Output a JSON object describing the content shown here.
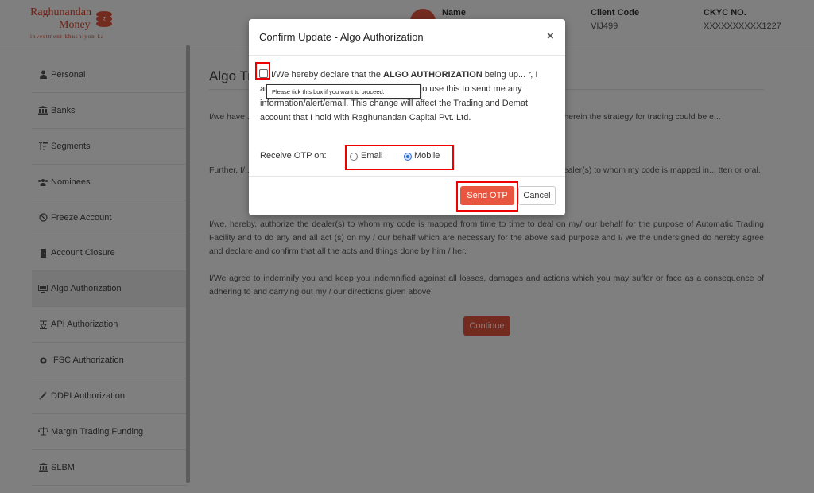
{
  "header": {
    "logo_line1": "Raghunandan",
    "logo_line2": "Money",
    "logo_tagline": "investment khushiyon ka",
    "name_label": "Name",
    "client_code_label": "Client Code",
    "client_code_value": "VIJ499",
    "ckyc_label": "CKYC NO.",
    "ckyc_value": "XXXXXXXXXX1227",
    "brand_color": "#e8563f"
  },
  "sidebar": {
    "items": [
      {
        "label": "Personal",
        "icon": "user-icon"
      },
      {
        "label": "Banks",
        "icon": "bank-icon"
      },
      {
        "label": "Segments",
        "icon": "sort-icon"
      },
      {
        "label": "Nominees",
        "icon": "users-icon"
      },
      {
        "label": "Freeze Account",
        "icon": "ban-icon"
      },
      {
        "label": "Account Closure",
        "icon": "door-icon"
      },
      {
        "label": "Algo Authorization",
        "icon": "monitor-icon"
      },
      {
        "label": "API Authorization",
        "icon": "api-icon"
      },
      {
        "label": "IFSC Authorization",
        "icon": "gear-icon"
      },
      {
        "label": "DDPI Authorization",
        "icon": "wand-icon"
      },
      {
        "label": "Margin Trading Funding",
        "icon": "scale-icon"
      },
      {
        "label": "SLBM",
        "icon": "building-icon"
      }
    ],
    "active_index": 6
  },
  "main": {
    "title": "Algo Tr",
    "paragraphs": [
      "I/we have ... cash) segment and/or Futures & Options segment and/or Cu... atic trading facility wherein the strategy for trading could be e...",
      "Further, I/ ... ch can be operated through a dealer. Therefore, in order to e... our consent to the dealer(s) to whom my code is mapped in... tten or oral.",
      "I/we, hereby, authorize the dealer(s) to whom my code is mapped from time to time to deal on my/ our behalf for the purpose of Automatic Trading Facility and to do any and all act (s) on my / our behalf which are necessary for the above said purpose and I/ we the undersigned do hereby agree and declare and confirm that all the acts and things done by him / her.",
      "I/We agree to indemnify you and keep you indemnified against all losses, damages and actions which you may suffer or face as a consequence of adhering to and carrying out my / our directions given above."
    ],
    "continue_label": "Continue"
  },
  "modal": {
    "title": "Confirm Update - Algo Authorization",
    "close_symbol": "×",
    "declaration_prefix": "I/We hereby declare that the ",
    "declaration_bold": "ALGO AUTHORIZATION",
    "declaration_suffix": " being up... r, I authorise Raghunandan Capital Pvt. Ltd. to use this to send me any information/alert/email. This change will affect the Trading and Demat account that I hold with Raghunandan Capital Pvt. Ltd.",
    "tooltip": "Please tick this box if you want to proceed.",
    "otp_label": "Receive OTP on:",
    "otp_options": [
      {
        "label": "Email",
        "checked": false
      },
      {
        "label": "Mobile",
        "checked": true
      }
    ],
    "send_otp_label": "Send OTP",
    "cancel_label": "Cancel",
    "highlight_color": "#e00000"
  }
}
